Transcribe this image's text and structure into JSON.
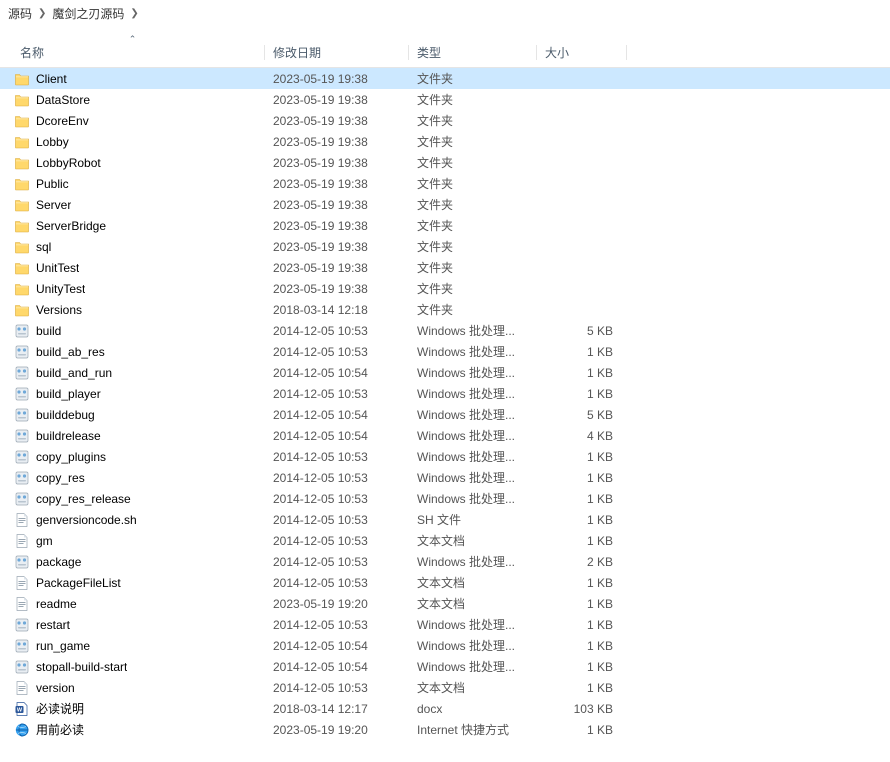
{
  "breadcrumb": {
    "seg0": "源码",
    "seg1": "魔剑之刃源码"
  },
  "columns": {
    "name": "名称",
    "date": "修改日期",
    "type": "类型",
    "size": "大小"
  },
  "items": [
    {
      "icon": "folder",
      "name": "Client",
      "date": "2023-05-19 19:38",
      "type": "文件夹",
      "size": "",
      "selected": true
    },
    {
      "icon": "folder",
      "name": "DataStore",
      "date": "2023-05-19 19:38",
      "type": "文件夹",
      "size": ""
    },
    {
      "icon": "folder",
      "name": "DcoreEnv",
      "date": "2023-05-19 19:38",
      "type": "文件夹",
      "size": ""
    },
    {
      "icon": "folder",
      "name": "Lobby",
      "date": "2023-05-19 19:38",
      "type": "文件夹",
      "size": ""
    },
    {
      "icon": "folder",
      "name": "LobbyRobot",
      "date": "2023-05-19 19:38",
      "type": "文件夹",
      "size": ""
    },
    {
      "icon": "folder",
      "name": "Public",
      "date": "2023-05-19 19:38",
      "type": "文件夹",
      "size": ""
    },
    {
      "icon": "folder",
      "name": "Server",
      "date": "2023-05-19 19:38",
      "type": "文件夹",
      "size": ""
    },
    {
      "icon": "folder",
      "name": "ServerBridge",
      "date": "2023-05-19 19:38",
      "type": "文件夹",
      "size": ""
    },
    {
      "icon": "folder",
      "name": "sql",
      "date": "2023-05-19 19:38",
      "type": "文件夹",
      "size": ""
    },
    {
      "icon": "folder",
      "name": "UnitTest",
      "date": "2023-05-19 19:38",
      "type": "文件夹",
      "size": ""
    },
    {
      "icon": "folder",
      "name": "UnityTest",
      "date": "2023-05-19 19:38",
      "type": "文件夹",
      "size": ""
    },
    {
      "icon": "folder",
      "name": "Versions",
      "date": "2018-03-14 12:18",
      "type": "文件夹",
      "size": ""
    },
    {
      "icon": "bat",
      "name": "build",
      "date": "2014-12-05 10:53",
      "type": "Windows 批处理...",
      "size": "5 KB"
    },
    {
      "icon": "bat",
      "name": "build_ab_res",
      "date": "2014-12-05 10:53",
      "type": "Windows 批处理...",
      "size": "1 KB"
    },
    {
      "icon": "bat",
      "name": "build_and_run",
      "date": "2014-12-05 10:54",
      "type": "Windows 批处理...",
      "size": "1 KB"
    },
    {
      "icon": "bat",
      "name": "build_player",
      "date": "2014-12-05 10:53",
      "type": "Windows 批处理...",
      "size": "1 KB"
    },
    {
      "icon": "bat",
      "name": "builddebug",
      "date": "2014-12-05 10:54",
      "type": "Windows 批处理...",
      "size": "5 KB"
    },
    {
      "icon": "bat",
      "name": "buildrelease",
      "date": "2014-12-05 10:54",
      "type": "Windows 批处理...",
      "size": "4 KB"
    },
    {
      "icon": "bat",
      "name": "copy_plugins",
      "date": "2014-12-05 10:53",
      "type": "Windows 批处理...",
      "size": "1 KB"
    },
    {
      "icon": "bat",
      "name": "copy_res",
      "date": "2014-12-05 10:53",
      "type": "Windows 批处理...",
      "size": "1 KB"
    },
    {
      "icon": "bat",
      "name": "copy_res_release",
      "date": "2014-12-05 10:53",
      "type": "Windows 批处理...",
      "size": "1 KB"
    },
    {
      "icon": "txt",
      "name": "genversioncode.sh",
      "date": "2014-12-05 10:53",
      "type": "SH 文件",
      "size": "1 KB"
    },
    {
      "icon": "txt",
      "name": "gm",
      "date": "2014-12-05 10:53",
      "type": "文本文档",
      "size": "1 KB"
    },
    {
      "icon": "bat",
      "name": "package",
      "date": "2014-12-05 10:53",
      "type": "Windows 批处理...",
      "size": "2 KB"
    },
    {
      "icon": "txt",
      "name": "PackageFileList",
      "date": "2014-12-05 10:53",
      "type": "文本文档",
      "size": "1 KB"
    },
    {
      "icon": "txt",
      "name": "readme",
      "date": "2023-05-19 19:20",
      "type": "文本文档",
      "size": "1 KB"
    },
    {
      "icon": "bat",
      "name": "restart",
      "date": "2014-12-05 10:53",
      "type": "Windows 批处理...",
      "size": "1 KB"
    },
    {
      "icon": "bat",
      "name": "run_game",
      "date": "2014-12-05 10:54",
      "type": "Windows 批处理...",
      "size": "1 KB"
    },
    {
      "icon": "bat",
      "name": "stopall-build-start",
      "date": "2014-12-05 10:54",
      "type": "Windows 批处理...",
      "size": "1 KB"
    },
    {
      "icon": "txt",
      "name": "version",
      "date": "2014-12-05 10:53",
      "type": "文本文档",
      "size": "1 KB"
    },
    {
      "icon": "docx",
      "name": "必读说明",
      "date": "2018-03-14 12:17",
      "type": "docx",
      "size": "103 KB"
    },
    {
      "icon": "url",
      "name": "用前必读",
      "date": "2023-05-19 19:20",
      "type": "Internet 快捷方式",
      "size": "1 KB"
    }
  ]
}
